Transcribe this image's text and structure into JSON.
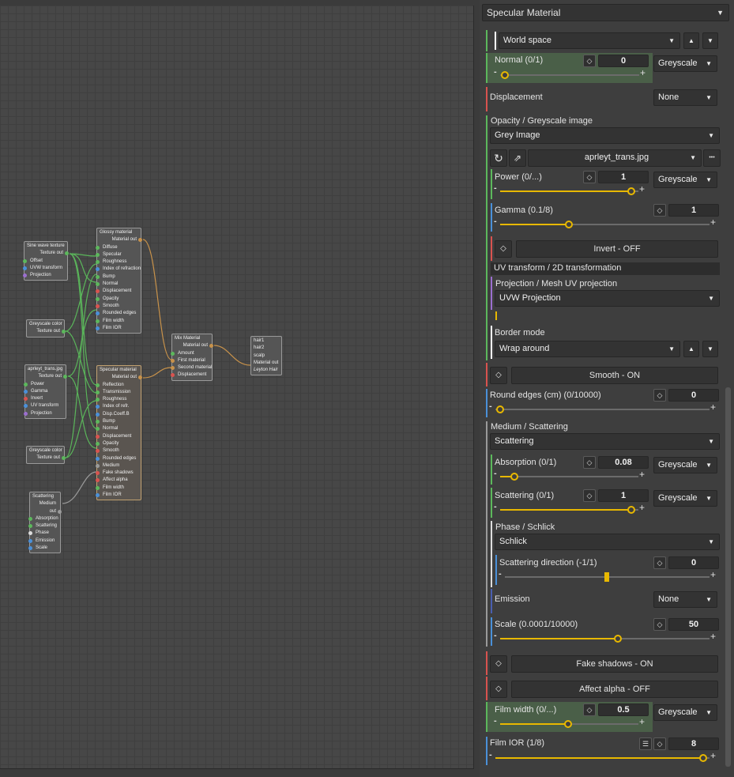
{
  "editor": {
    "nodes": [
      {
        "key": "sine",
        "title": "Sine wave texture",
        "output": "Texture out",
        "inputs": [
          "Offset",
          "UVW transform",
          "Projection"
        ]
      },
      {
        "key": "grey1",
        "title": "Greyscale color",
        "output": "Texture out",
        "inputs": []
      },
      {
        "key": "img",
        "title": "aprleyt_trans.jpg",
        "output": "Texture out",
        "inputs": [
          "Power",
          "Gamma",
          "Invert",
          "UV transform",
          "Projection"
        ]
      },
      {
        "key": "grey2",
        "title": "Greyscale color",
        "output": "Texture out",
        "inputs": []
      },
      {
        "key": "scat",
        "title": "Scattering",
        "output": "Medium out",
        "inputs": [
          "Absorption",
          "Scattering",
          "Phase",
          "Emission",
          "Scale"
        ]
      },
      {
        "key": "glossy",
        "title": "Glossy material",
        "output": "Material out",
        "inputs": [
          "Diffuse",
          "Specular",
          "Roughness",
          "Index of refraction",
          "Bump",
          "Normal",
          "Displacement",
          "Opacity",
          "Smooth",
          "Rounded edges",
          "Film width",
          "Film IOR"
        ]
      },
      {
        "key": "spec",
        "title": "Specular material",
        "output": "Material out",
        "inputs": [
          "Reflection",
          "Transmission",
          "Roughness",
          "Index of refr.",
          "Disp.Coeff.B",
          "Bump",
          "Normal",
          "Displacement",
          "Opacity",
          "Smooth",
          "Rounded edges",
          "Medium",
          "Fake shadows",
          "Affect alpha",
          "Film width",
          "Film IOR"
        ]
      },
      {
        "key": "mix",
        "title": "Mix Material",
        "output": "Material out",
        "inputs": [
          "Amount",
          "First material",
          "Second material",
          "Displacement"
        ]
      },
      {
        "key": "hair",
        "title": "",
        "output": "",
        "inputs": [
          "hair1",
          "hair2",
          "scalp",
          "Material out",
          "Leyton Hair"
        ]
      }
    ]
  },
  "inspector": {
    "header": "Specular Material",
    "world_space": "World space",
    "normal": {
      "label": "Normal (0/1)",
      "value": "0",
      "mode": "Greyscale",
      "fraction": 0.0
    },
    "displacement": {
      "label": "Displacement",
      "mode": "None"
    },
    "opacity": {
      "label": "Opacity / Greyscale image",
      "type": "Grey Image",
      "file": "aprleyt_trans.jpg",
      "more": "•••"
    },
    "power": {
      "label": "Power (0/...)",
      "value": "1",
      "mode": "Greyscale",
      "fraction": 1.0
    },
    "gamma": {
      "label": "Gamma (0.1/8)",
      "value": "1",
      "fraction": 0.12
    },
    "invert": "Invert - OFF",
    "uv_transform": "UV transform / 2D transformation",
    "projection": {
      "label": "Projection / Mesh UV projection",
      "value": "UVW Projection"
    },
    "border_mode": {
      "label": "Border mode",
      "value": "Wrap around"
    },
    "smooth": "Smooth - ON",
    "round_edges": {
      "label": "Round edges (cm) (0/10000)",
      "value": "0",
      "fraction": 0.0
    },
    "medium": {
      "label": "Medium / Scattering",
      "value": "Scattering"
    },
    "absorption": {
      "label": "Absorption (0/1)",
      "value": "0.08",
      "mode": "Greyscale",
      "fraction": 0.08
    },
    "scattering": {
      "label": "Scattering (0/1)",
      "value": "1",
      "mode": "Greyscale",
      "fraction": 1.0
    },
    "phase": {
      "label": "Phase / Schlick",
      "value": "Schlick"
    },
    "scat_dir": {
      "label": "Scattering direction (-1/1)",
      "value": "0",
      "fraction": 0.5
    },
    "emission": {
      "label": "Emission",
      "mode": "None"
    },
    "scale": {
      "label": "Scale (0.0001/10000)",
      "value": "50",
      "fraction": 0.56
    },
    "fake_shadows": "Fake shadows - ON",
    "affect_alpha": "Affect alpha - OFF",
    "film_width": {
      "label": "Film width (0/...)",
      "value": "0.5",
      "mode": "Greyscale",
      "fraction": 0.5
    },
    "film_ior": {
      "label": "Film IOR (1/8)",
      "value": "8",
      "fraction": 1.0
    },
    "glyphs": {
      "dropdown": "▼",
      "up": "▲",
      "down": "▼",
      "minus": "-",
      "plus": "+",
      "keyframe": "◇",
      "refresh": "↻",
      "open": "⇗",
      "list": "☰"
    }
  },
  "colors": {
    "accent": "#e8b800",
    "green_pin": "#5cb85c",
    "blue_pin": "#4a90d9",
    "red_pin": "#d9534f",
    "purple_pin": "#9b6fcf",
    "wire_green": "#5ab55a",
    "wire_orange": "#c8924a",
    "wire_grey": "#9a9a9a"
  }
}
